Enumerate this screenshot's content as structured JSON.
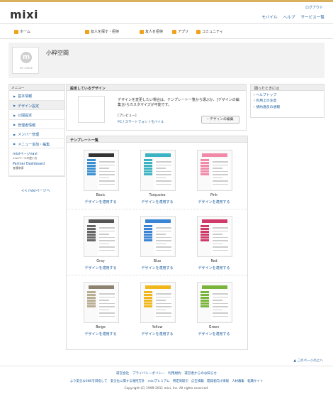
{
  "header": {
    "logo": "mixi",
    "logout": "ログアウト",
    "links": [
      "モバイル",
      "ヘルプ",
      "サービス一覧"
    ]
  },
  "nav": {
    "items": [
      {
        "label": "ホーム",
        "color": "#f3a11b"
      },
      {
        "label": "友人を探す・招待",
        "color": "#f3a11b"
      },
      {
        "label": "友人を招待",
        "color": "#f3a11b"
      },
      {
        "label": "アプリ",
        "color": "#f3a11b"
      },
      {
        "label": "コミュニティ",
        "color": "#f3a11b"
      }
    ]
  },
  "profile": {
    "avatar_letter": "m",
    "no_image": "NO IMAGE",
    "name": "小粋空間"
  },
  "menu": {
    "title": "メニュー",
    "items": [
      {
        "label": "基本情報"
      },
      {
        "label": "デザイン設定"
      },
      {
        "label": "公開設定"
      },
      {
        "label": "管理者情報"
      },
      {
        "label": "メンバー管理"
      },
      {
        "label": "メニュー追加・編集"
      }
    ],
    "sub": [
      {
        "link": "mixiページnavi",
        "desc": "mixiページの使い方"
      },
      {
        "link": "Partner Dashboard",
        "desc": "各種申請"
      }
    ],
    "back": "<< mixiページへ"
  },
  "design": {
    "title": "設定しているデザイン",
    "text": "デザインを変更したい場合は、テンプレート一覧から選ぶか、[デザインの編集]からカスタマイズが可能です。",
    "preview_label": "[プレビュー]",
    "preview_pc": "PC",
    "preview_sep1": "/",
    "preview_sp": "スマートフォン",
    "preview_sep2": "/",
    "preview_mobile": "モバイル",
    "edit_button": "› デザインの編集"
  },
  "templates": {
    "title": "テンプレート一覧",
    "apply_label": "デザインを適用する",
    "items": [
      {
        "name": "Basic",
        "color": "#3a8fd0",
        "head": "#333333"
      },
      {
        "name": "Turquoise",
        "color": "#3bb3c3",
        "head": "#3bb3c3"
      },
      {
        "name": "Pink",
        "color": "#f08aa8",
        "head": "#f08aa8"
      },
      {
        "name": "Gray",
        "color": "#666666",
        "head": "#555555"
      },
      {
        "name": "Blue",
        "color": "#3a84d6",
        "head": "#3a84d6"
      },
      {
        "name": "Red",
        "color": "#d03a6a",
        "head": "#d03a6a"
      },
      {
        "name": "Beige",
        "color": "#b9ad93",
        "head": "#8c826d"
      },
      {
        "name": "Yellow",
        "color": "#f0b71d",
        "head": "#f0b71d"
      },
      {
        "name": "Green",
        "color": "#7ab43a",
        "head": "#7ab43a"
      }
    ]
  },
  "help": {
    "title": "困ったときには",
    "links": [
      "ヘルプトップ",
      "利用上の注意",
      "規約違反の通報"
    ]
  },
  "pagetop": "▲ このページの上へ",
  "footer": {
    "row1": "運営会社　プライバシーポリシー　利用規約　運営者からのお知らせ",
    "row2": "より安全なSNSを目指して　安全化に関する運用方針　mixiプレミアム　特定商取引　広告掲載　開発者向け情報　人材募集　転職サイト",
    "copyright": "Copyright (C) 1999-2011 mixi, Inc. All rights reserved."
  }
}
